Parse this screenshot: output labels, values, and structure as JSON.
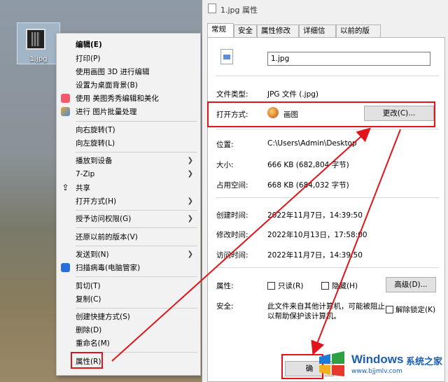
{
  "desktop": {
    "icon_label": "1.jpg"
  },
  "context_menu": {
    "items": [
      {
        "label": "编辑(E)",
        "bold": true
      },
      {
        "label": "打印(P)"
      },
      {
        "label": "使用画图 3D 进行编辑"
      },
      {
        "label": "设置为桌面背景(B)"
      },
      {
        "label": "使用 美图秀秀编辑和美化",
        "icon": "meitu-icon"
      },
      {
        "label": "进行 图片批量处理",
        "icon": "batch-image-icon"
      },
      {
        "label": "向右旋转(T)"
      },
      {
        "label": "向左旋转(L)"
      },
      {
        "label": "播放到设备"
      },
      {
        "label": "7-Zip"
      },
      {
        "label": "共享",
        "icon": "share-icon"
      },
      {
        "label": "打开方式(H)"
      },
      {
        "label": "授予访问权限(G)"
      },
      {
        "label": "还原以前的版本(V)"
      },
      {
        "label": "发送到(N)"
      },
      {
        "label": "扫描病毒(电脑管家)",
        "icon": "shield-icon"
      },
      {
        "label": "剪切(T)"
      },
      {
        "label": "复制(C)"
      },
      {
        "label": "创建快捷方式(S)"
      },
      {
        "label": "删除(D)"
      },
      {
        "label": "重命名(M)"
      },
      {
        "label": "属性(R)"
      }
    ]
  },
  "dialog": {
    "title": "1.jpg 属性",
    "tabs": [
      "常规",
      "安全",
      "属性修改",
      "详细信息",
      "以前的版本"
    ],
    "file_name": "1.jpg",
    "type_label": "文件类型:",
    "type_value": "JPG 文件 (.jpg)",
    "open_with_label": "打开方式:",
    "open_with_value": "画图",
    "change_button": "更改(C)...",
    "location_label": "位置:",
    "location_value": "C:\\Users\\Admin\\Desktop",
    "size_label": "大小:",
    "size_value": "666 KB (682,804 字节)",
    "size_on_disk_label": "占用空间:",
    "size_on_disk_value": "668 KB (684,032 字节)",
    "created_label": "创建时间:",
    "created_value": "2022年11月7日，14:39:50",
    "modified_label": "修改时间:",
    "modified_value": "2022年10月13日，17:58:00",
    "accessed_label": "访问时间:",
    "accessed_value": "2022年11月7日，14:39:50",
    "attributes_label": "属性:",
    "readonly_label": "只读(R)",
    "hidden_label": "隐藏(H)",
    "advanced_button": "高级(D)...",
    "security_label": "安全:",
    "security_text_1": "此文件来自其他计算机，可能被阻止",
    "security_text_2": "以帮助保护该计算机。",
    "unblock_label": "解除锁定(K)",
    "ok_button": "确"
  },
  "watermark": {
    "brand": "Windows",
    "suffix": "系统之家",
    "url": "www.bjjmlv.com"
  },
  "colors": {
    "highlight_red": "#e0141a",
    "brand_blue": "#1a5fb4"
  }
}
